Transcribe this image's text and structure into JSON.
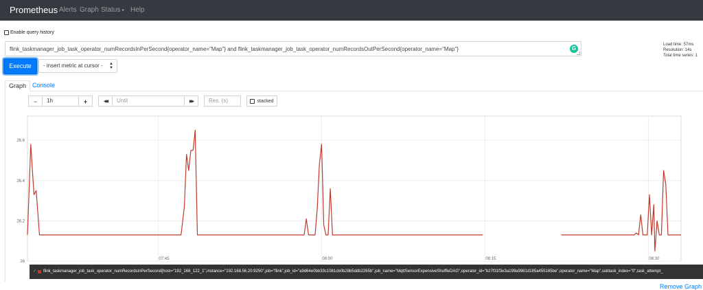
{
  "navbar": {
    "brand": "Prometheus",
    "links": [
      "Alerts",
      "Graph",
      "Status",
      "Help"
    ],
    "caret": "▾"
  },
  "query_history_label": "Enable query history",
  "expression": "flink_taskmanager_job_task_operator_numRecordsInPerSecond{operator_name=\"Map\"} and flink_taskmanager_job_task_operator_numRecordsOutPerSecond{operator_name=\"Map\"}",
  "grammarly_badge": "G",
  "stats": {
    "load_time": "Load time: 57ms",
    "resolution": "Resolution: 14s",
    "total_series": "Total time series: 1"
  },
  "execute_label": "Execute",
  "insert_metric_label": "- insert metric at cursor -",
  "tabs": {
    "graph": "Graph",
    "console": "Console"
  },
  "controls": {
    "minus": "−",
    "range": "1h",
    "plus": "+",
    "back": "◀◀",
    "until_placeholder": "Until",
    "forward": "▶▶",
    "res_placeholder": "Res. (s)",
    "stacked": "stacked"
  },
  "colors": {
    "series": "#c0392b",
    "navbar": "#343a40",
    "link": "#007bff"
  },
  "chart_data": {
    "type": "line",
    "ylim": [
      26.0,
      26.72
    ],
    "y_ticks": [
      26,
      26.2,
      26.4,
      26.6
    ],
    "y_tick_labels": [
      "26",
      "26.2",
      "26.4",
      "26.6"
    ],
    "x_ticks": [
      "07:45",
      "08:00",
      "08:15",
      "08:30"
    ],
    "x_tick_minutes": [
      453,
      468,
      483,
      498
    ],
    "xlim_minutes": [
      441,
      501
    ],
    "grid": true,
    "series": [
      {
        "segments": [
          [
            [
              441.0,
              26.13
            ],
            [
              441.3,
              26.58
            ],
            [
              441.6,
              26.33
            ],
            [
              441.8,
              26.35
            ],
            [
              442.1,
              26.13
            ],
            [
              455.1,
              26.13
            ],
            [
              455.4,
              26.27
            ],
            [
              455.6,
              26.53
            ],
            [
              455.8,
              26.45
            ],
            [
              456.0,
              26.55
            ],
            [
              456.2,
              26.55
            ],
            [
              456.4,
              26.65
            ],
            [
              456.6,
              26.13
            ],
            [
              466.4,
              26.13
            ],
            [
              466.6,
              26.21
            ],
            [
              466.8,
              26.13
            ],
            [
              467.4,
              26.13
            ],
            [
              467.6,
              26.26
            ],
            [
              467.8,
              26.48
            ],
            [
              468.0,
              26.58
            ],
            [
              468.2,
              26.18
            ],
            [
              468.4,
              26.13
            ],
            [
              468.6,
              26.13
            ],
            [
              468.8,
              26.36
            ],
            [
              469.0,
              26.13
            ],
            [
              482.8,
              26.13
            ]
          ],
          [
            [
              490.0,
              26.13
            ],
            [
              496.7,
              26.13
            ],
            [
              496.9,
              26.14
            ],
            [
              497.1,
              26.13
            ],
            [
              497.3,
              26.23
            ],
            [
              497.5,
              26.13
            ],
            [
              497.9,
              26.13
            ],
            [
              498.1,
              26.33
            ],
            [
              498.3,
              26.13
            ],
            [
              498.5,
              26.28
            ],
            [
              498.6,
              26.05
            ],
            [
              498.8,
              26.2
            ],
            [
              499.0,
              26.13
            ],
            [
              499.2,
              26.13
            ],
            [
              499.4,
              26.45
            ],
            [
              499.6,
              26.38
            ],
            [
              499.8,
              26.13
            ],
            [
              501.0,
              26.13
            ]
          ]
        ]
      }
    ]
  },
  "legend": {
    "check": "✓",
    "text": "flink_taskmanager_job_task_operator_numRecordsInPerSecond{host=\"192_168_122_1\",instance=\"192.168.56.20:9250\",job=\"flink\",job_id=\"a9d64e0bb33c1081cb0b28b5ddb2265b\",job_name=\"MqttSensorExpensiveShuffleDAG\",operator_id=\"b27f31f3e3a199a9981d185a455185be\",operator_name=\"Map\",subtask_index=\"0\",task_attempt_"
  },
  "remove_graph_label": "Remove Graph"
}
